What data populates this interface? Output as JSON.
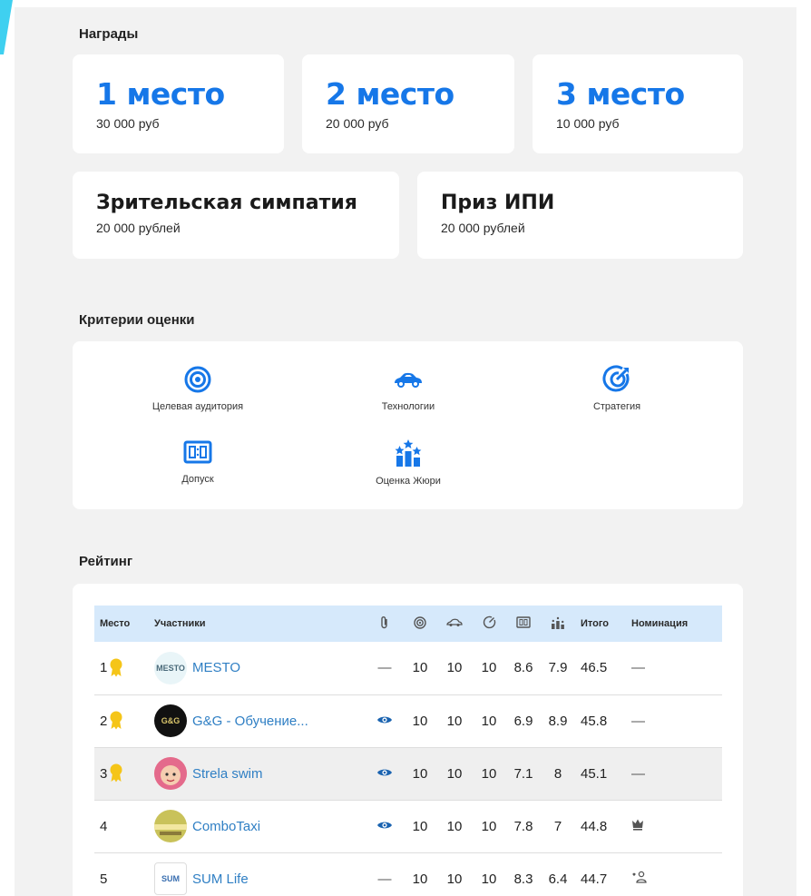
{
  "awards": {
    "title": "Награды",
    "cards": [
      {
        "title": "1 место",
        "amount": "30 000 руб"
      },
      {
        "title": "2 место",
        "amount": "20 000 руб"
      },
      {
        "title": "3 место",
        "amount": "10 000 руб"
      },
      {
        "title": "Зрительская симпатия",
        "amount": "20 000 рублей"
      },
      {
        "title": "Приз ИПИ",
        "amount": "20 000 рублей"
      }
    ]
  },
  "criteria": {
    "title": "Критерии оценки",
    "items": [
      {
        "label": "Целевая аудитория",
        "icon": "target-icon"
      },
      {
        "label": "Технологии",
        "icon": "car-icon"
      },
      {
        "label": "Стратегия",
        "icon": "strategy-icon"
      },
      {
        "label": "Допуск",
        "icon": "scoreboard-icon"
      },
      {
        "label": "Оценка Жюри",
        "icon": "jury-stars-icon"
      }
    ]
  },
  "rating": {
    "title": "Рейтинг",
    "headers": {
      "place": "Место",
      "participants": "Участники",
      "total": "Итого",
      "nomination": "Номинация"
    },
    "rows": [
      {
        "place": "1",
        "name": "MESTO",
        "avatar_text": "MESTO",
        "attach": "—",
        "s1": "10",
        "s2": "10",
        "s3": "10",
        "s4": "8.6",
        "s5": "7.9",
        "total": "46.5",
        "nomination": "—"
      },
      {
        "place": "2",
        "name": "G&G - Обучение...",
        "avatar_text": "G&G",
        "attach": "eye",
        "s1": "10",
        "s2": "10",
        "s3": "10",
        "s4": "6.9",
        "s5": "8.9",
        "total": "45.8",
        "nomination": "—"
      },
      {
        "place": "3",
        "name": "Strela swim",
        "avatar_text": "",
        "attach": "eye",
        "s1": "10",
        "s2": "10",
        "s3": "10",
        "s4": "7.1",
        "s5": "8",
        "total": "45.1",
        "nomination": "—"
      },
      {
        "place": "4",
        "name": "ComboTaxi",
        "avatar_text": "",
        "attach": "eye",
        "s1": "10",
        "s2": "10",
        "s3": "10",
        "s4": "7.8",
        "s5": "7",
        "total": "44.8",
        "nomination": "crown-icon"
      },
      {
        "place": "5",
        "name": "SUM Life",
        "avatar_text": "SUM",
        "attach": "—",
        "s1": "10",
        "s2": "10",
        "s3": "10",
        "s4": "8.3",
        "s5": "6.4",
        "total": "44.7",
        "nomination": "audience-icon"
      }
    ]
  },
  "colors": {
    "accent": "#1677e8",
    "link": "#2f7fc4",
    "header_bg": "#d6e9fb",
    "medal": "#f5c518"
  }
}
